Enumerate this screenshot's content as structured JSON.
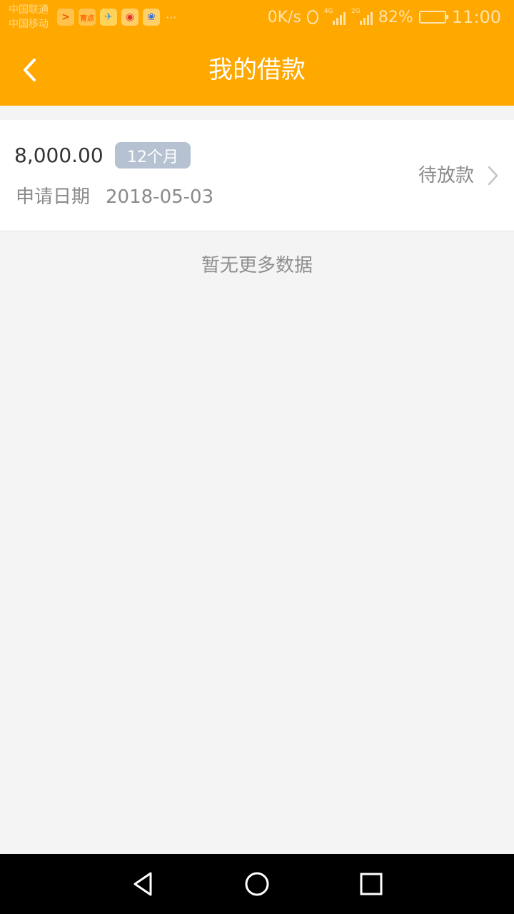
{
  "status_bar": {
    "carrier_1": "中国联通",
    "carrier_2": "中国移动",
    "notif_icon_2_text": "育点",
    "more": "···",
    "net_speed": "0K/s",
    "signal_1_tag": "4G",
    "signal_2_tag": "2G",
    "battery_percent": "82%",
    "battery_level": 0.82,
    "time": "11:00"
  },
  "header": {
    "title": "我的借款"
  },
  "loan": {
    "amount": "8,000.00",
    "term": "12个月",
    "date_label": "申请日期",
    "date_value": "2018-05-03",
    "status": "待放款"
  },
  "list": {
    "end_text": "暂无更多数据"
  },
  "colors": {
    "brand": "#ffa800",
    "badge": "#b6c2d2",
    "background": "#f4f4f4"
  }
}
